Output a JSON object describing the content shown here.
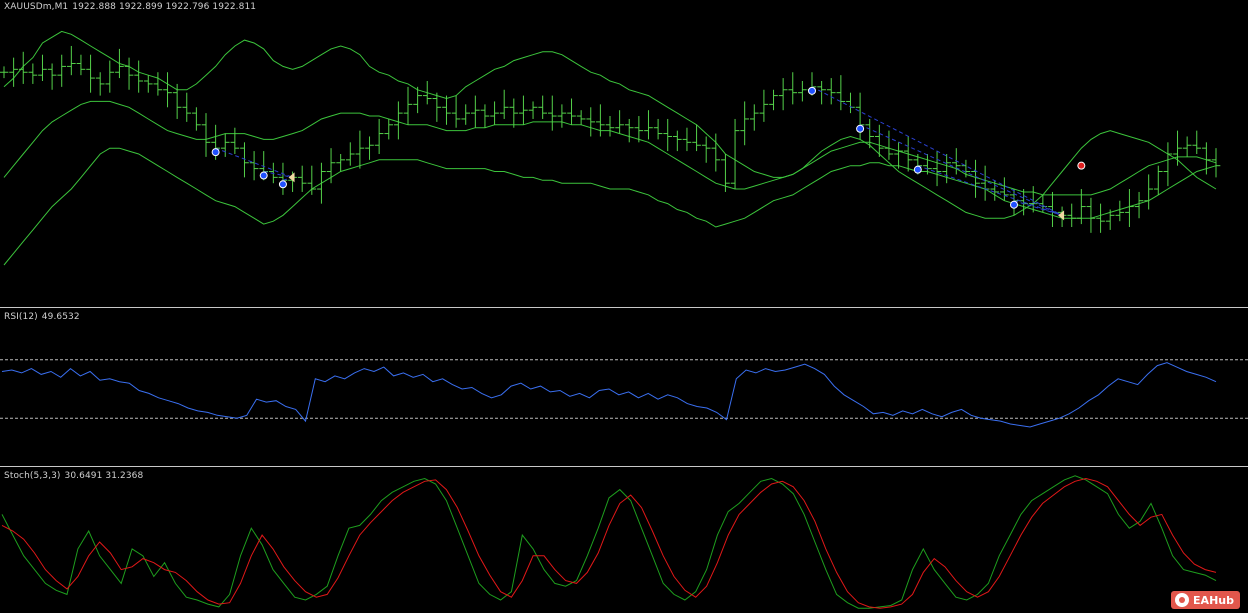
{
  "main_pane": {
    "symbol_label": "XAUUSDm,M1",
    "ohlc_label": "1922.888 1922.899 1922.796 1922.811"
  },
  "rsi_pane": {
    "label": "RSI(12)",
    "value_label": "49.6532"
  },
  "stoch_pane": {
    "label": "Stoch(5,3,3)",
    "value_label": "30.6491 31.2368"
  },
  "watermark": {
    "text": "EAHub"
  },
  "colors": {
    "background": "#000000",
    "candles": "#55d24a",
    "bands": "#3cc43c",
    "rsi_line": "#3a6ff0",
    "stoch_main": "#1e9e1e",
    "stoch_signal": "#e01818",
    "signal_marker": "#2050ff",
    "arrow_marker": "#f0d8a0",
    "zigzag": "#2b40d0",
    "level_lines": "#bbbbbb"
  },
  "chart_data": [
    {
      "type": "candlestick",
      "panel": "main",
      "ylim": [
        0,
        100
      ],
      "close": [
        78,
        79,
        78,
        77,
        79,
        77,
        80,
        81,
        79,
        76,
        74,
        78,
        80,
        77,
        75,
        74,
        72,
        71,
        66,
        64,
        60,
        54,
        52,
        54,
        52,
        47,
        45,
        44,
        42,
        41,
        42,
        40,
        38,
        44,
        47,
        48,
        50,
        52,
        53,
        57,
        60,
        64,
        67,
        70,
        69,
        66,
        64,
        62,
        64,
        65,
        63,
        64,
        66,
        64,
        65,
        66,
        64,
        63,
        64,
        63,
        62,
        61,
        60,
        59,
        60,
        59,
        58,
        59,
        57,
        56,
        55,
        54,
        53,
        52,
        48,
        40,
        58,
        62,
        64,
        67,
        70,
        72,
        71,
        72,
        73,
        72,
        71,
        68,
        66,
        60,
        56,
        52,
        50,
        51,
        48,
        46,
        45,
        44,
        47,
        46,
        44,
        40,
        38,
        37,
        36,
        34,
        33,
        33,
        32,
        30,
        29,
        28,
        32,
        28,
        27,
        29,
        30,
        32,
        34,
        38,
        44,
        50,
        52,
        53,
        52,
        48,
        46
      ],
      "bollinger": {
        "upper": [
          73,
          76,
          80,
          83,
          88,
          90,
          92,
          91,
          89,
          87,
          85,
          83,
          81,
          80,
          78,
          77,
          76,
          74,
          72,
          72,
          74,
          77,
          80,
          84,
          87,
          89,
          88,
          86,
          82,
          80,
          79,
          80,
          82,
          84,
          86,
          87,
          86,
          84,
          80,
          78,
          77,
          75,
          74,
          72,
          71,
          70,
          69,
          70,
          73,
          75,
          77,
          79,
          80,
          82,
          83,
          84,
          85,
          85,
          84,
          82,
          80,
          78,
          77,
          75,
          74,
          72,
          71,
          70,
          68,
          66,
          64,
          62,
          60,
          57,
          54,
          50,
          48,
          46,
          44,
          43,
          42,
          42,
          43,
          45,
          48,
          51,
          53,
          55,
          56,
          55,
          53,
          50,
          47,
          44,
          42,
          40,
          38,
          36,
          34,
          32,
          30,
          29,
          28,
          28,
          28,
          29,
          31,
          33,
          36,
          40,
          44,
          48,
          52,
          55,
          57,
          58,
          57,
          56,
          55,
          54,
          52,
          50,
          48,
          45,
          42,
          40,
          38
        ],
        "middle": [
          42,
          46,
          50,
          54,
          58,
          61,
          63,
          65,
          67,
          68,
          68,
          68,
          67,
          66,
          64,
          62,
          60,
          58,
          57,
          56,
          55,
          55,
          56,
          57,
          57,
          57,
          56,
          55,
          55,
          56,
          57,
          58,
          60,
          62,
          63,
          64,
          64,
          64,
          63,
          63,
          62,
          61,
          60,
          60,
          60,
          59,
          58,
          58,
          58,
          59,
          59,
          60,
          60,
          60,
          60,
          61,
          61,
          61,
          61,
          60,
          60,
          59,
          58,
          58,
          57,
          56,
          55,
          54,
          52,
          50,
          48,
          46,
          44,
          42,
          40,
          39,
          38,
          38,
          39,
          40,
          41,
          42,
          43,
          45,
          47,
          49,
          51,
          52,
          53,
          54,
          54,
          53,
          52,
          51,
          50,
          49,
          48,
          47,
          46,
          45,
          43,
          42,
          41,
          40,
          39,
          38,
          37,
          37,
          36,
          36,
          36,
          36,
          36,
          36,
          37,
          38,
          40,
          42,
          44,
          46,
          47,
          48,
          49,
          49,
          49,
          48,
          47
        ],
        "lower": [
          12,
          16,
          20,
          24,
          28,
          32,
          35,
          38,
          42,
          46,
          50,
          52,
          52,
          51,
          50,
          48,
          46,
          44,
          42,
          40,
          38,
          36,
          34,
          33,
          32,
          30,
          28,
          26,
          27,
          29,
          32,
          35,
          38,
          40,
          42,
          44,
          45,
          46,
          47,
          48,
          48,
          48,
          48,
          48,
          47,
          46,
          45,
          45,
          45,
          45,
          45,
          44,
          44,
          43,
          42,
          42,
          41,
          41,
          40,
          40,
          40,
          40,
          39,
          38,
          38,
          38,
          37,
          36,
          34,
          33,
          31,
          30,
          28,
          27,
          25,
          26,
          27,
          28,
          30,
          32,
          34,
          35,
          36,
          38,
          40,
          42,
          44,
          45,
          46,
          46,
          47,
          47,
          46,
          46,
          45,
          44,
          44,
          43,
          42,
          41,
          40,
          39,
          38,
          36,
          34,
          33,
          32,
          31,
          30,
          29,
          28,
          28,
          28,
          28,
          29,
          30,
          31,
          32,
          33,
          34,
          36,
          38,
          40,
          42,
          44,
          45,
          46
        ]
      },
      "buy_signals": [
        22,
        27,
        29,
        84,
        89,
        95,
        105
      ],
      "arrow_markers": [
        30,
        110
      ],
      "sell_markers": [
        112
      ]
    },
    {
      "type": "line",
      "panel": "rsi",
      "title": "RSI(12) 49.6532",
      "ylim": [
        0,
        100
      ],
      "levels": [
        70,
        30
      ],
      "values": [
        62,
        63,
        61,
        64,
        60,
        62,
        58,
        64,
        59,
        62,
        56,
        57,
        55,
        54,
        49,
        47,
        44,
        42,
        40,
        37,
        35,
        34,
        32,
        31,
        30,
        32,
        43,
        41,
        42,
        38,
        36,
        28,
        57,
        55,
        59,
        57,
        61,
        64,
        62,
        65,
        59,
        61,
        58,
        60,
        55,
        57,
        53,
        50,
        51,
        47,
        44,
        46,
        52,
        54,
        50,
        52,
        48,
        49,
        45,
        47,
        44,
        49,
        50,
        46,
        48,
        44,
        47,
        43,
        46,
        44,
        40,
        38,
        37,
        34,
        29,
        57,
        63,
        61,
        64,
        62,
        63,
        65,
        67,
        64,
        60,
        52,
        46,
        42,
        38,
        33,
        34,
        32,
        35,
        33,
        36,
        33,
        31,
        34,
        36,
        32,
        30,
        29,
        28,
        26,
        25,
        24,
        26,
        28,
        30,
        33,
        37,
        42,
        46,
        52,
        57,
        55,
        53,
        60,
        66,
        68,
        65,
        62,
        60,
        58,
        55
      ],
      "x_count": 125
    },
    {
      "type": "line",
      "panel": "stochastic",
      "title": "Stoch(5,3,3) 30.6491 31.2368",
      "ylim": [
        0,
        100
      ],
      "series": [
        {
          "name": "main",
          "values": [
            70,
            55,
            40,
            30,
            20,
            15,
            12,
            45,
            58,
            40,
            30,
            20,
            45,
            40,
            25,
            35,
            20,
            10,
            8,
            5,
            3,
            12,
            40,
            60,
            48,
            30,
            20,
            10,
            8,
            12,
            18,
            40,
            60,
            62,
            70,
            80,
            86,
            90,
            94,
            96,
            92,
            80,
            60,
            40,
            20,
            12,
            8,
            14,
            55,
            45,
            30,
            20,
            18,
            22,
            40,
            60,
            82,
            88,
            80,
            60,
            40,
            20,
            12,
            8,
            14,
            30,
            55,
            72,
            78,
            86,
            94,
            96,
            92,
            85,
            70,
            50,
            30,
            12,
            6,
            2,
            2,
            3,
            4,
            8,
            30,
            45,
            30,
            20,
            10,
            8,
            12,
            20,
            40,
            55,
            70,
            80,
            85,
            90,
            95,
            98,
            95,
            90,
            85,
            70,
            60,
            65,
            78,
            60,
            40,
            30,
            28,
            26,
            22
          ]
        },
        {
          "name": "signal",
          "values": [
            62,
            58,
            52,
            42,
            30,
            22,
            16,
            25,
            40,
            50,
            42,
            30,
            32,
            38,
            35,
            30,
            28,
            22,
            14,
            8,
            5,
            6,
            20,
            40,
            55,
            45,
            32,
            22,
            14,
            10,
            12,
            24,
            40,
            55,
            64,
            72,
            80,
            86,
            90,
            94,
            95,
            88,
            75,
            58,
            40,
            26,
            14,
            10,
            22,
            40,
            40,
            30,
            22,
            20,
            28,
            42,
            62,
            78,
            84,
            75,
            58,
            40,
            25,
            15,
            10,
            18,
            35,
            55,
            70,
            78,
            86,
            92,
            94,
            90,
            80,
            65,
            45,
            28,
            14,
            6,
            3,
            2,
            3,
            5,
            12,
            28,
            38,
            32,
            22,
            14,
            10,
            14,
            25,
            40,
            55,
            68,
            78,
            84,
            90,
            94,
            96,
            94,
            90,
            80,
            70,
            62,
            68,
            70,
            55,
            42,
            34,
            30,
            28
          ]
        }
      ]
    }
  ]
}
